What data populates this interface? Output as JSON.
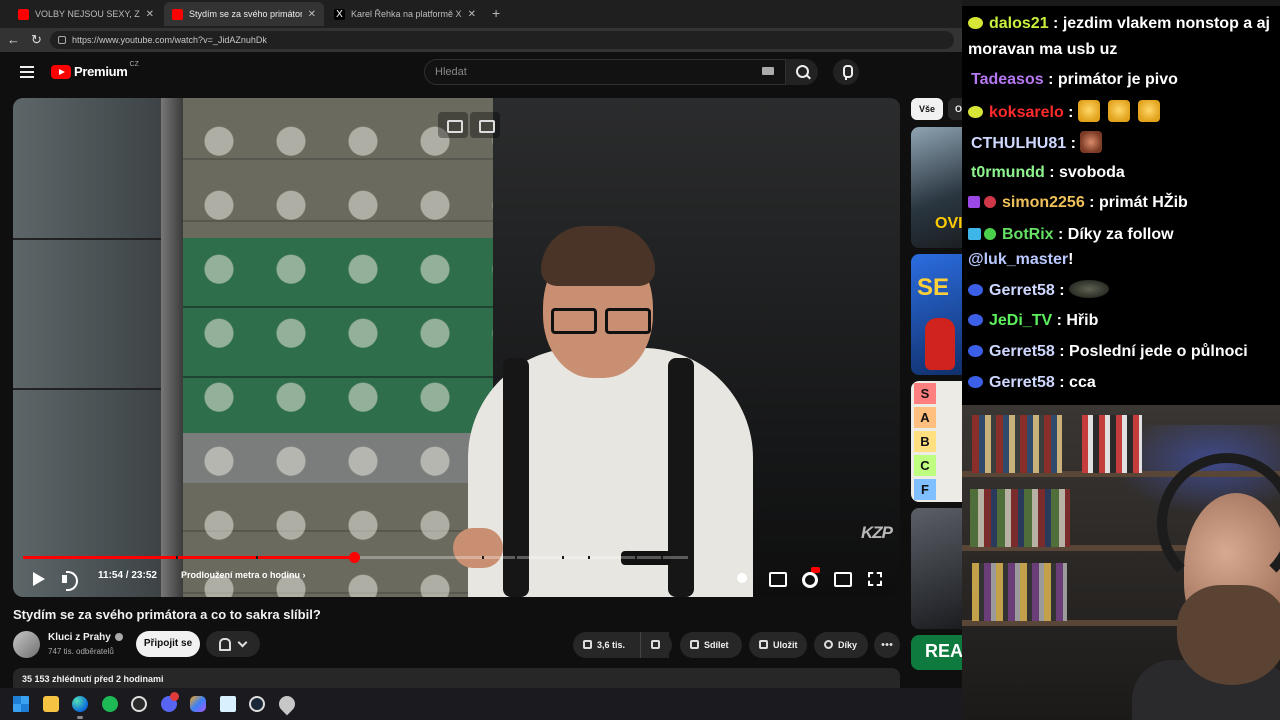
{
  "browser": {
    "tabs": [
      {
        "title": "VOLBY NEJSOU SEXY, Z NICH NEM",
        "active": false,
        "favicon_color": "#ff0000"
      },
      {
        "title": "Stydím se za svého primátora",
        "active": true,
        "favicon_color": "#ff0000"
      },
      {
        "title": "Karel Řehka na platformě X: „Po vi",
        "active": false,
        "favicon_color": "#ffffff"
      }
    ],
    "new_tab_label": "+",
    "url": "https://www.youtube.com/watch?v=_JidAZnuhDk"
  },
  "youtube": {
    "brand": "Premium",
    "country_code": "CZ",
    "search_placeholder": "Hledat",
    "accent": "#ff0000"
  },
  "player": {
    "time_display": "11:54 / 23:52",
    "chapter_title": "Prodloužení metra o hodinu",
    "progress_fraction": 0.498,
    "chapter_marks": [
      0.23,
      0.35,
      0.69,
      0.74,
      0.81,
      0.85,
      0.92,
      0.96
    ],
    "watermark": "KZP"
  },
  "video": {
    "title": "Stydím se za svého primátora a co to sakra slíbil?",
    "channel_name": "Kluci z Prahy",
    "subscribers": "747 tis. odběratelů",
    "join_label": "Připojit se",
    "likes": "3,6 tis.",
    "share_label": "Sdílet",
    "save_label": "Uložit",
    "thanks_label": "Díky",
    "views_line": "35 153 zhlédnutí  před 2 hodinami"
  },
  "sidebar": {
    "chip_all": "Vše",
    "chip_next": "O",
    "thumb_texts": [
      "OVI",
      "SE",
      "REA"
    ],
    "tier_labels": [
      {
        "label": "S",
        "color": "#ff7f7f"
      },
      {
        "label": "A",
        "color": "#ffbf7f"
      },
      {
        "label": "B",
        "color": "#ffdf7f"
      },
      {
        "label": "C",
        "color": "#bfff7f"
      },
      {
        "label": "F",
        "color": "#7fbfff"
      }
    ]
  },
  "chat": {
    "messages": [
      {
        "user": "dalos21",
        "color": "#c8f03c",
        "badge": "yellow",
        "text": " : jezdim vlakem nonstop a aj",
        "cont": "moravan ma usb uz"
      },
      {
        "user": "Tadeasos",
        "color": "#b678f2",
        "badge": "",
        "text": " : primátor je pivo"
      },
      {
        "user": "koksarelo",
        "color": "#ff2a2a",
        "badge": "yellow",
        "text": " : ",
        "emotes": 3
      },
      {
        "user": "CTHULHU81",
        "color": "#cfd8ff",
        "badge": "",
        "text": " : "
      },
      {
        "user": "t0rmundd",
        "color": "#8ef58e",
        "badge": "",
        "text": " : svoboda"
      },
      {
        "user": "simon2256",
        "color": "#f0c05a",
        "badge": "purple-red",
        "text": " : primát HŽib"
      },
      {
        "user": "BotRix",
        "color": "#65e065",
        "badge": "botrix",
        "text": " : Díky za follow",
        "mention": "@luk_master",
        "mention_suffix": "!"
      },
      {
        "user": "Gerret58",
        "color": "#cfd8ff",
        "badge": "blue",
        "text": " : "
      },
      {
        "user": "JeDi_TV",
        "color": "#5df05d",
        "badge": "blue",
        "text": " : Hřib"
      },
      {
        "user": "Gerret58",
        "color": "#cfd8ff",
        "badge": "blue",
        "text": " : Poslední jede o půlnoci"
      },
      {
        "user": "Gerret58",
        "color": "#cfd8ff",
        "badge": "blue",
        "text": " : cca"
      }
    ]
  }
}
